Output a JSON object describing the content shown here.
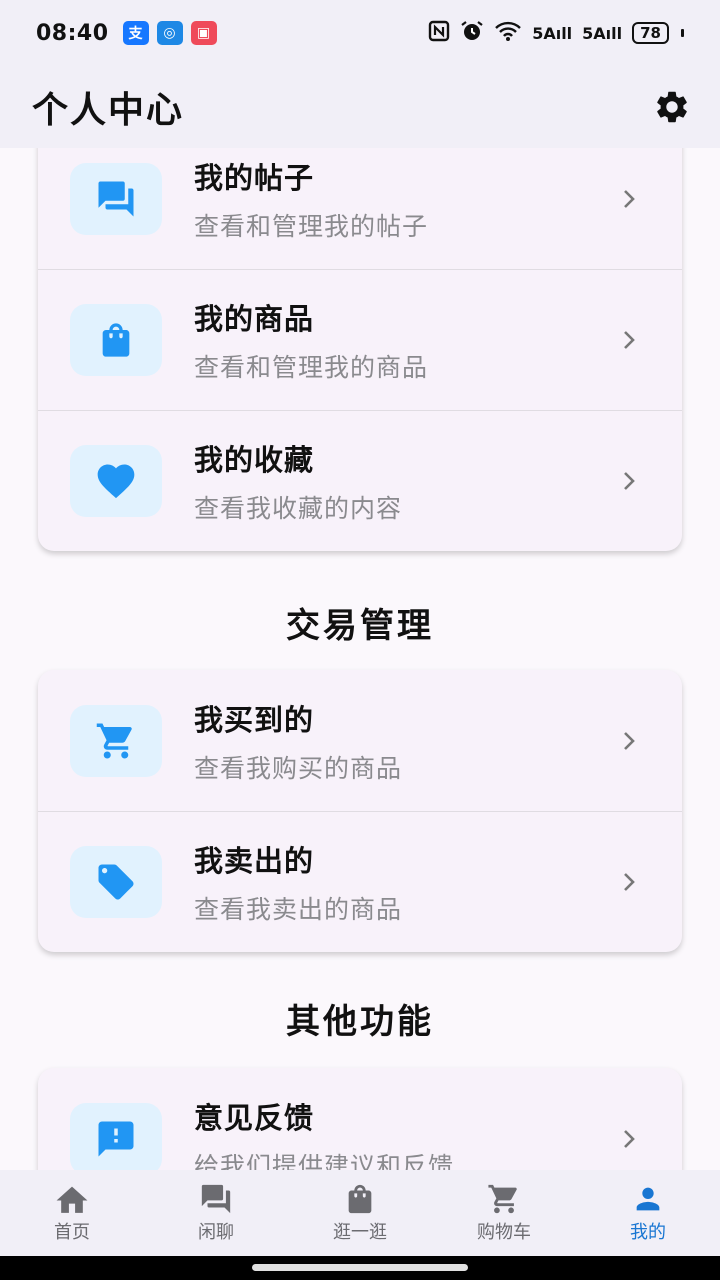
{
  "status_bar": {
    "time": "08:40",
    "app_badges": [
      {
        "label": "支",
        "color": "#1677ff"
      },
      {
        "label": "◎",
        "color": "#1e88e5"
      },
      {
        "label": "▣",
        "color": "#ef4a5a"
      }
    ],
    "icons": [
      "nfc-icon",
      "alarm-icon",
      "wifi-icon",
      "signal-icon",
      "signal-icon"
    ],
    "signal_1": "5Aıll",
    "signal_2": "5Aıll",
    "battery": "78"
  },
  "header": {
    "title": "个人中心",
    "settings_icon": "gear-icon"
  },
  "sections": [
    {
      "title": "",
      "items": [
        {
          "icon": "chat-icon",
          "title": "我的帖子",
          "subtitle": "查看和管理我的帖子"
        },
        {
          "icon": "shopping-bag-icon",
          "title": "我的商品",
          "subtitle": "查看和管理我的商品"
        },
        {
          "icon": "heart-icon",
          "title": "我的收藏",
          "subtitle": "查看我收藏的内容"
        }
      ]
    },
    {
      "title": "交易管理",
      "items": [
        {
          "icon": "cart-icon",
          "title": "我买到的",
          "subtitle": "查看我购买的商品"
        },
        {
          "icon": "tag-icon",
          "title": "我卖出的",
          "subtitle": "查看我卖出的商品"
        }
      ]
    },
    {
      "title": "其他功能",
      "items": [
        {
          "icon": "feedback-icon",
          "title": "意见反馈",
          "subtitle": "给我们提供建议和反馈"
        }
      ]
    }
  ],
  "bottom_nav": {
    "items": [
      {
        "label": "首页",
        "icon": "home-icon"
      },
      {
        "label": "闲聊",
        "icon": "chat-icon"
      },
      {
        "label": "逛一逛",
        "icon": "shopping-bag-icon"
      },
      {
        "label": "购物车",
        "icon": "cart-icon"
      },
      {
        "label": "我的",
        "icon": "person-icon"
      }
    ],
    "active_index": 4
  },
  "colors": {
    "accent": "#2196f3",
    "active_nav": "#1976d2",
    "icon_bg": "#e1f2fe",
    "inactive_nav": "#6b6b70"
  }
}
